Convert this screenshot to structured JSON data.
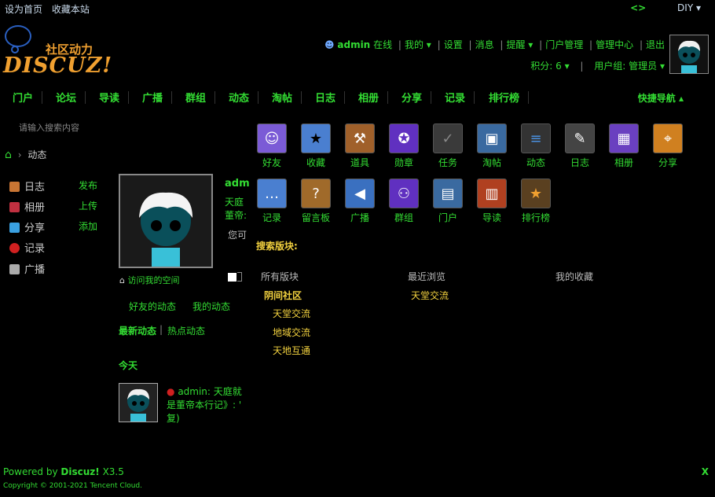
{
  "topbar": {
    "set_home": "设为首页",
    "bookmark": "收藏本站",
    "code_icon": "<>",
    "diy": "DIY"
  },
  "logo": {
    "slogan": "社区动力",
    "word": "DISCUZ!"
  },
  "user": {
    "name": "admin",
    "status": "在线",
    "links": [
      "我的",
      "设置",
      "消息",
      "提醒",
      "门户管理",
      "管理中心",
      "退出"
    ],
    "credits": "积分: 6",
    "group": "用户组: 管理员"
  },
  "nav": {
    "items": [
      "门户",
      "论坛",
      "导读",
      "广播",
      "群组",
      "动态",
      "淘帖",
      "日志",
      "相册",
      "分享",
      "记录",
      "排行榜"
    ],
    "quick": "快捷导航"
  },
  "search": {
    "placeholder": "请输入搜索内容"
  },
  "breadcrumb": {
    "current": "动态"
  },
  "sidebar": [
    {
      "label": "日志",
      "action": "发布",
      "color": "#c87533"
    },
    {
      "label": "相册",
      "action": "上传",
      "color": "#c03040"
    },
    {
      "label": "分享",
      "action": "添加",
      "color": "#3aa0e0"
    },
    {
      "label": "记录",
      "action": "",
      "color": "#d02020"
    },
    {
      "label": "广播",
      "action": "",
      "color": "#aaaaaa"
    }
  ],
  "profile": {
    "name": "adm",
    "line1": "天庭\u0001",
    "line2": "董帝:",
    "gray": "您可",
    "visit": "访问我的空间"
  },
  "feed": {
    "tabs": [
      "好友的动态",
      "我的动态"
    ],
    "subtabs": [
      "最新动态",
      "热点动态"
    ],
    "today": "今天",
    "entry": "admin: 天庭就是董帝本行记》: ' 复)"
  },
  "apps_row1": [
    {
      "label": "好友",
      "color": "#7b5bd6",
      "glyph": "☺"
    },
    {
      "label": "收藏",
      "color": "#4a7fd0",
      "glyph": "★"
    },
    {
      "label": "道具",
      "color": "#a0602a",
      "glyph": "⚒"
    },
    {
      "label": "勋章",
      "color": "#6030c0",
      "glyph": "✪"
    },
    {
      "label": "任务",
      "color": "#3a3a3a",
      "glyph": "✓"
    },
    {
      "label": "淘帖",
      "color": "#3a6aa0",
      "glyph": "▣"
    },
    {
      "label": "动态",
      "color": "#333333",
      "glyph": "≡"
    },
    {
      "label": "日志",
      "color": "#444444",
      "glyph": "✎"
    },
    {
      "label": "相册",
      "color": "#6a40c0",
      "glyph": "▦"
    },
    {
      "label": "分享",
      "color": "#d08020",
      "glyph": "⌖"
    }
  ],
  "apps_row2": [
    {
      "label": "记录",
      "color": "#4a7fd0",
      "glyph": "…"
    },
    {
      "label": "留言板",
      "color": "#a06a2a",
      "glyph": "?"
    },
    {
      "label": "广播",
      "color": "#3a70c0",
      "glyph": "◀"
    },
    {
      "label": "群组",
      "color": "#6030c0",
      "glyph": "⚇"
    },
    {
      "label": "门户",
      "color": "#3a6aa0",
      "glyph": "▤"
    },
    {
      "label": "导读",
      "color": "#b04020",
      "glyph": "▥"
    },
    {
      "label": "排行榜",
      "color": "#5a4020",
      "glyph": "★"
    }
  ],
  "search_block": {
    "title": "搜索版块:",
    "cols": [
      "所有版块",
      "最近浏览",
      "我的收藏"
    ],
    "group": "阴间社区",
    "forums": [
      "天堂交流",
      "地域交流",
      "天地互通"
    ],
    "recent": "天堂交流"
  },
  "footer": {
    "powered": "Powered by",
    "brand": "Discuz!",
    "version": "X3.5",
    "copyright": "Copyright © 2001-2021 Tencent Cloud.",
    "x": "X"
  }
}
